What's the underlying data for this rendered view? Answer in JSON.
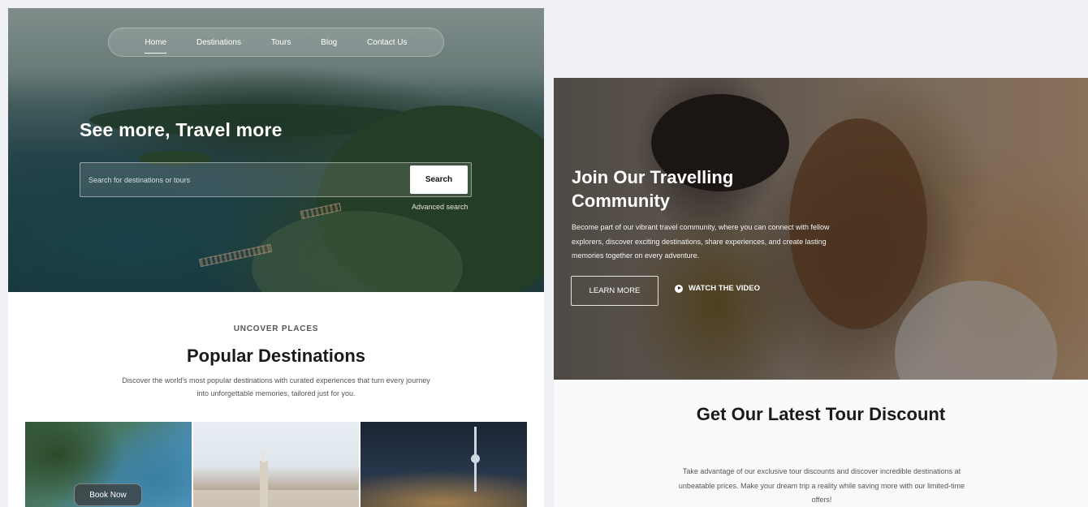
{
  "left": {
    "nav": {
      "items": [
        "Home",
        "Destinations",
        "Tours",
        "Blog",
        "Contact Us"
      ],
      "active": "Home"
    },
    "hero": {
      "title": "See more, Travel more",
      "search_placeholder": "Search for destinations or tours",
      "search_button": "Search",
      "advanced_search": "Advanced search"
    },
    "popular": {
      "eyebrow": "UNCOVER PLACES",
      "title": "Popular Destinations",
      "description": "Discover the world's most popular destinations with curated experiences that turn every journey into unforgettable memories, tailored just for you.",
      "book_now": "Book Now"
    }
  },
  "right": {
    "community": {
      "title": "Join Our Travelling Community",
      "description": "Become part of our vibrant travel community, where you can connect with fellow explorers, discover exciting destinations, share experiences, and create lasting memories together on every adventure.",
      "learn_more": "LEARN MORE",
      "watch_video": "WATCH THE VIDEO"
    },
    "discount": {
      "title": "Get Our Latest Tour Discount",
      "description": "Take advantage of our exclusive tour discounts and discover incredible destinations at unbeatable prices. Make your dream trip a reality while saving more with our limited-time offers!"
    }
  },
  "icons": {
    "play": "play-icon"
  },
  "colors": {
    "page_background": "#eff1f4",
    "heading": "#1a1a1a",
    "body_text": "#555555",
    "button_light": "#ffffff"
  }
}
